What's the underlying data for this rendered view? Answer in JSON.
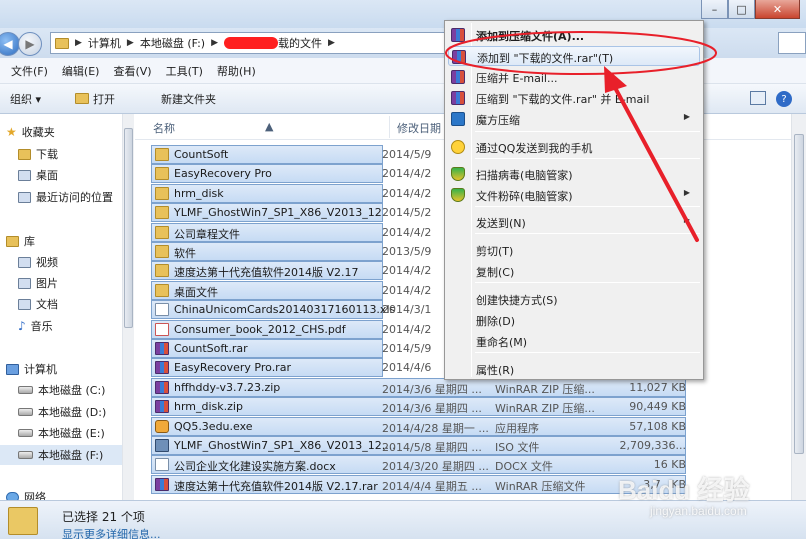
{
  "window": {
    "min": "–",
    "max": "□",
    "close": "✕"
  },
  "address": {
    "crumbs": [
      "计算机",
      "本地磁盘 (F:)",
      "载的文件"
    ]
  },
  "menubar": [
    "文件(F)",
    "编辑(E)",
    "查看(V)",
    "工具(T)",
    "帮助(H)"
  ],
  "toolbar": {
    "organize": "组织 ▾",
    "open": "打开",
    "new_folder": "新建文件夹",
    "help": "?"
  },
  "nav": {
    "favorites": "收藏夹",
    "downloads": "下载",
    "desktop": "桌面",
    "recent": "最近访问的位置",
    "library": "库",
    "videos": "视频",
    "pictures": "图片",
    "documents": "文档",
    "music": "音乐",
    "computer": "计算机",
    "drive_c": "本地磁盘 (C:)",
    "drive_d": "本地磁盘 (D:)",
    "drive_e": "本地磁盘 (E:)",
    "drive_f": "本地磁盘 (F:)",
    "network": "网络"
  },
  "columns": {
    "name": "名称",
    "date": "修改日期"
  },
  "files": [
    {
      "name": "CountSoft",
      "date": "2014/5/9",
      "type": "",
      "size": "",
      "icon": "folder"
    },
    {
      "name": "EasyRecovery Pro",
      "date": "2014/4/2",
      "type": "",
      "size": "",
      "icon": "folder"
    },
    {
      "name": "hrm_disk",
      "date": "2014/4/2",
      "type": "",
      "size": "",
      "icon": "folder"
    },
    {
      "name": "YLMF_GhostWin7_SP1_X86_V2013_12",
      "date": "2014/5/2",
      "type": "",
      "size": "",
      "icon": "folder"
    },
    {
      "name": "公司章程文件",
      "date": "2014/4/2",
      "type": "",
      "size": "",
      "icon": "folder"
    },
    {
      "name": "软件",
      "date": "2013/5/9",
      "type": "",
      "size": "",
      "icon": "folder"
    },
    {
      "name": "速度达第十代充值软件2014版 V2.17",
      "date": "2014/4/2",
      "type": "",
      "size": "",
      "icon": "folder"
    },
    {
      "name": "桌面文件",
      "date": "2014/4/2",
      "type": "",
      "size": "",
      "icon": "folder"
    },
    {
      "name": "ChinaUnicomCards20140317160113.xls",
      "date": "2014/3/1",
      "type": "",
      "size": "",
      "icon": "xls"
    },
    {
      "name": "Consumer_book_2012_CHS.pdf",
      "date": "2014/4/2",
      "type": "",
      "size": "",
      "icon": "pdf"
    },
    {
      "name": "CountSoft.rar",
      "date": "2014/5/9",
      "type": "",
      "size": "",
      "icon": "rar"
    },
    {
      "name": "EasyRecovery Pro.rar",
      "date": "2014/4/6",
      "type": "",
      "size": "",
      "icon": "rar"
    },
    {
      "name": "hffhddy-v3.7.23.zip",
      "date": "2014/3/6 星期四 ...",
      "type": "WinRAR ZIP 压缩...",
      "size": "11,027 KB",
      "icon": "rar"
    },
    {
      "name": "hrm_disk.zip",
      "date": "2014/3/6 星期四 ...",
      "type": "WinRAR ZIP 压缩...",
      "size": "90,449 KB",
      "icon": "rar"
    },
    {
      "name": "QQ5.3edu.exe",
      "date": "2014/4/28 星期一 ...",
      "type": "应用程序",
      "size": "57,108 KB",
      "icon": "exe"
    },
    {
      "name": "YLMF_GhostWin7_SP1_X86_V2013_12....",
      "date": "2014/5/8 星期四 ...",
      "type": "ISO 文件",
      "size": "2,709,336...",
      "icon": "iso"
    },
    {
      "name": "公司企业文化建设实施方案.docx",
      "date": "2014/3/20 星期四 ...",
      "type": "DOCX 文件",
      "size": "16 KB",
      "icon": "docx"
    },
    {
      "name": "速度达第十代充值软件2014版 V2.17.rar",
      "date": "2014/4/4 星期五 ...",
      "type": "WinRAR 压缩文件",
      "size": "3,7.. KB",
      "icon": "rar"
    }
  ],
  "status": {
    "count": "已选择 21 个项",
    "more": "显示更多详细信息..."
  },
  "context_menu": [
    {
      "label": "添加到压缩文件(A)...",
      "icon": "rar",
      "bold": true,
      "sub": ""
    },
    {
      "label": "添加到 \"下载的文件.rar\"(T)",
      "icon": "rar",
      "bold": false,
      "sub": ""
    },
    {
      "label": "压缩并 E-mail...",
      "icon": "rar",
      "bold": false,
      "sub": ""
    },
    {
      "label": "压缩到 \"下载的文件.rar\" 并 E-mail",
      "icon": "rar",
      "bold": false,
      "sub": ""
    },
    {
      "label": "魔方压缩",
      "icon": "magic",
      "bold": false,
      "sub": "▶"
    },
    {
      "label": "通过QQ发送到我的手机",
      "icon": "qq",
      "bold": false,
      "sub": ""
    },
    {
      "label": "扫描病毒(电脑管家)",
      "icon": "shield",
      "bold": false,
      "sub": ""
    },
    {
      "label": "文件粉碎(电脑管家)",
      "icon": "shield",
      "bold": false,
      "sub": "▶"
    },
    {
      "label": "发送到(N)",
      "icon": "",
      "bold": false,
      "sub": "▶"
    },
    {
      "label": "剪切(T)",
      "icon": "",
      "bold": false,
      "sub": ""
    },
    {
      "label": "复制(C)",
      "icon": "",
      "bold": false,
      "sub": ""
    },
    {
      "label": "创建快捷方式(S)",
      "icon": "",
      "bold": false,
      "sub": ""
    },
    {
      "label": "删除(D)",
      "icon": "",
      "bold": false,
      "sub": ""
    },
    {
      "label": "重命名(M)",
      "icon": "",
      "bold": false,
      "sub": ""
    },
    {
      "label": "属性(R)",
      "icon": "",
      "bold": false,
      "sub": ""
    }
  ],
  "watermark": {
    "brand": "Baidu 经验",
    "url": "jingyan.baidu.com"
  },
  "colors": {
    "selection": "#cfe0f5",
    "annotation": "#e8202a",
    "accent": "#2f6bc7"
  }
}
